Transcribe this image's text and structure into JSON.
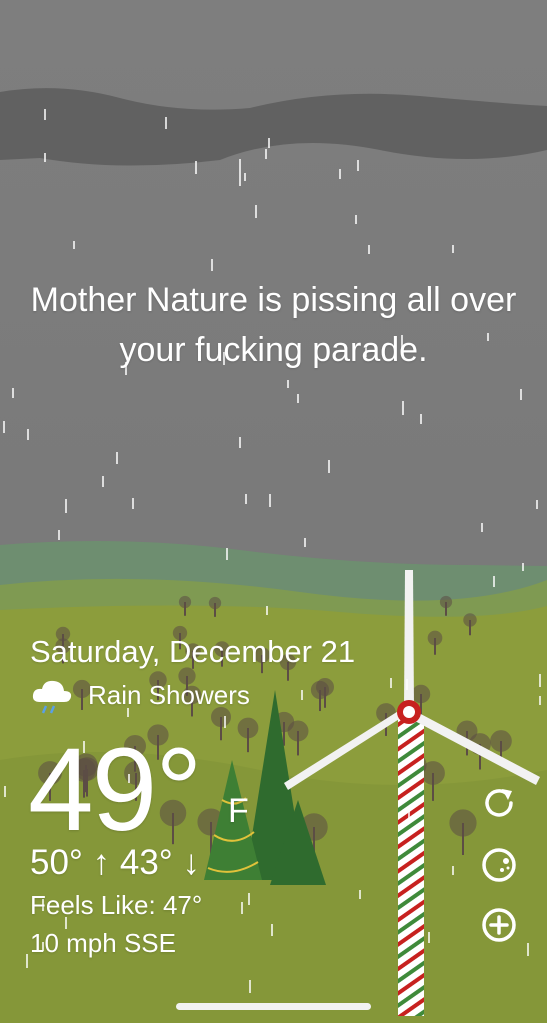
{
  "headline": "Mother Nature is pissing all over your fucking parade.",
  "date": "Saturday, December 21",
  "condition": {
    "label": "Rain Showers",
    "icon": "rain-cloud-icon"
  },
  "temperature": {
    "value": "49°",
    "unit": "F"
  },
  "high_low": "50° ↑  43° ↓",
  "feels_like": "Feels Like: 47°",
  "wind": "10 mph SSE",
  "controls": [
    {
      "name": "refresh-button",
      "icon": "refresh-icon"
    },
    {
      "name": "moon-button",
      "icon": "moon-icon"
    },
    {
      "name": "add-location-button",
      "icon": "plus-icon"
    }
  ],
  "colors": {
    "sky": "#7d7d7d",
    "cloud": "#5f5f5f",
    "far_hills": "#6a8c6b",
    "field": "#8c9d3c",
    "tree_dark": "#2f6b2e",
    "turbine_red": "#c7211f",
    "turbine_green": "#3f8a3a"
  }
}
